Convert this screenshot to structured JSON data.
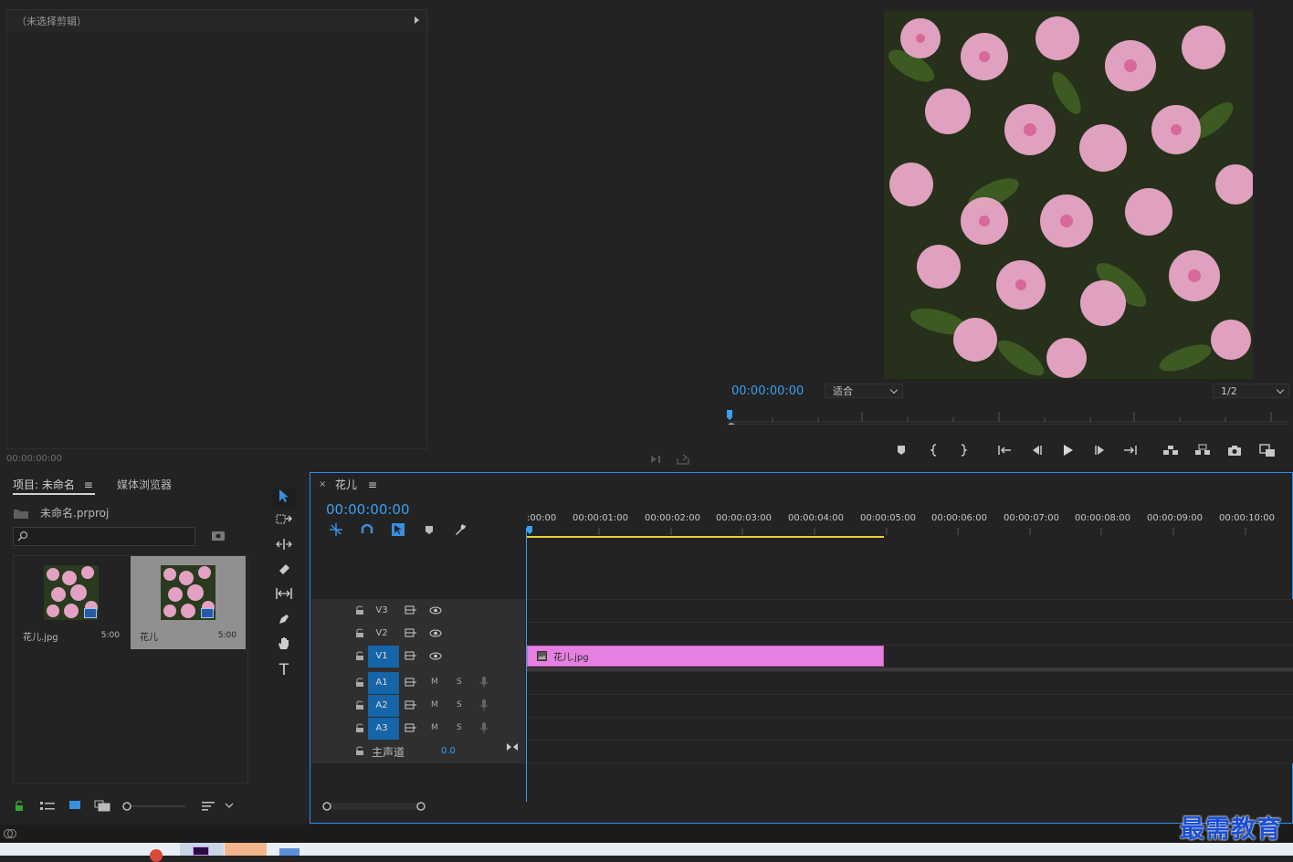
{
  "source_monitor": {
    "header": "（未选择剪辑）",
    "timecode": "00:00:00:00"
  },
  "program_monitor": {
    "timecode": "00:00:00:00",
    "fit_dropdown": "适合",
    "resolution_dropdown": "1/2"
  },
  "project_panel": {
    "tab_project": "项目: 未命名",
    "tab_media_browser": "媒体浏览器",
    "project_file": "未命名.prproj",
    "search_placeholder": "",
    "items": [
      {
        "name": "花儿.jpg",
        "duration": "5:00"
      },
      {
        "name": "花儿",
        "duration": "5:00"
      }
    ]
  },
  "timeline": {
    "sequence_name": "花儿",
    "timecode": "00:00:00:00",
    "ruler_labels": [
      ":00:00",
      "00:00:01:00",
      "00:00:02:00",
      "00:00:03:00",
      "00:00:04:00",
      "00:00:05:00",
      "00:00:06:00",
      "00:00:07:00",
      "00:00:08:00",
      "00:00:09:00",
      "00:00:10:00"
    ],
    "video_tracks": [
      "V3",
      "V2",
      "V1"
    ],
    "audio_tracks": [
      "A1",
      "A2",
      "A3"
    ],
    "mute_label": "M",
    "solo_label": "S",
    "master_label": "主声道",
    "master_value": "0.0",
    "clip_name": "花儿.jpg"
  },
  "watermark": "最需教育",
  "colors": {
    "accent_blue": "#3aa0f0",
    "clip_pink": "#e580e0",
    "track_active": "#1565a8",
    "work_area": "#e6d23a"
  }
}
